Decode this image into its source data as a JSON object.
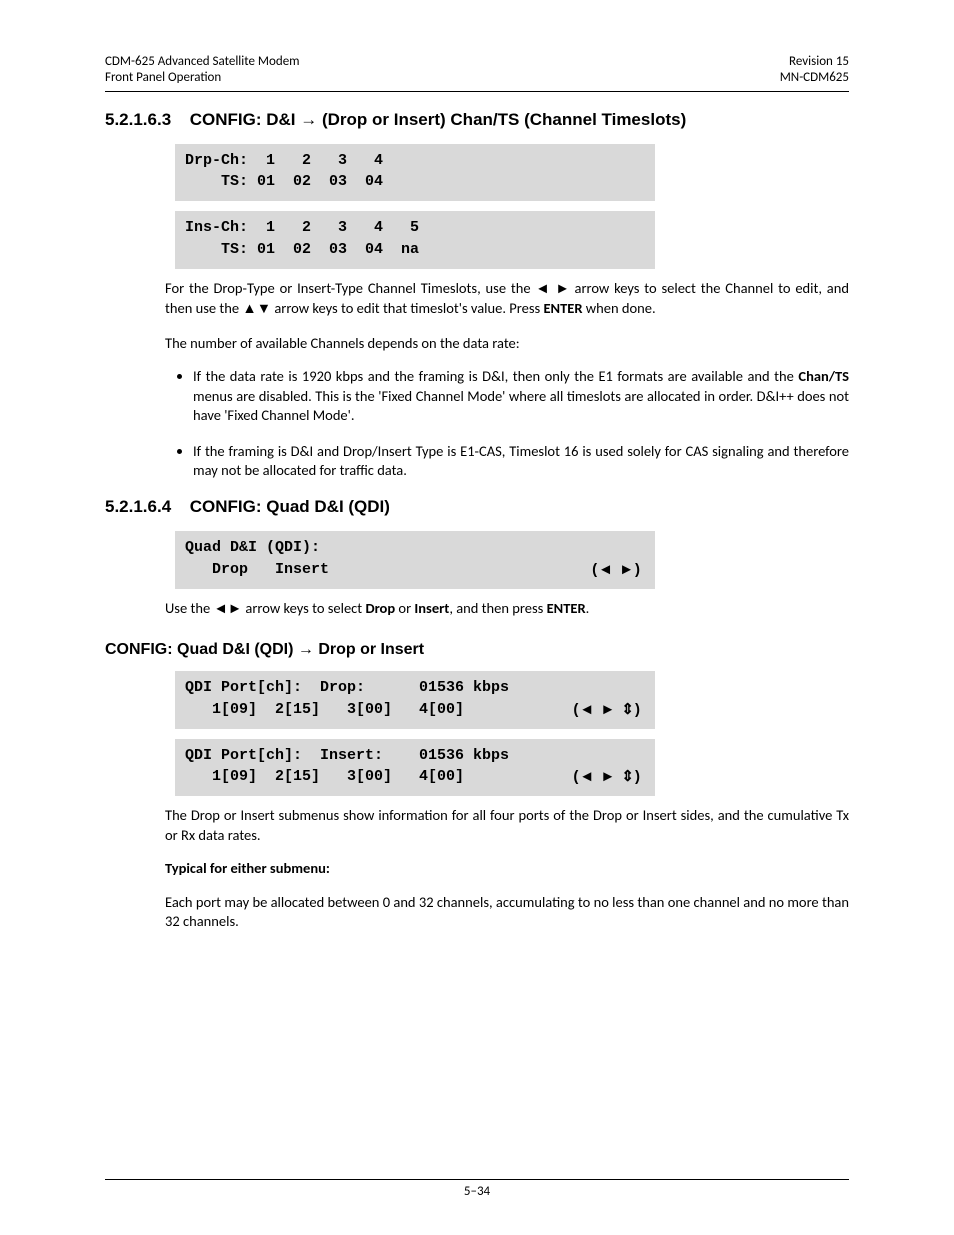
{
  "header": {
    "left1": "CDM-625 Advanced Satellite Modem",
    "left2": "Front Panel Operation",
    "right1": "Revision 15",
    "right2": "MN-CDM625"
  },
  "sec1": {
    "num": "5.2.1.6.3",
    "title_pre": "CONFIG: D&I ",
    "arrow": "→",
    "title_post": " (Drop or Insert) Chan/TS (Channel Timeslots)"
  },
  "lcd1": "Drp-Ch:  1   2   3   4\n    TS: 01  02  03  04",
  "lcd2": "Ins-Ch:  1   2   3   4   5\n    TS: 01  02  03  04  na",
  "para1_a": "For the Drop-Type or Insert-Type Channel Timeslots, use the ",
  "para1_lr": "◄ ►",
  "para1_b": " arrow keys to select the Channel to edit, and then use the ",
  "para1_ud": "▲▼",
  "para1_c": " arrow keys to edit that timeslot's value. Press ",
  "para1_enter": "ENTER",
  "para1_d": " when done.",
  "para2": "The number of available Channels depends on the data rate:",
  "bullet1_a": "If the data rate is 1920 kbps and the framing is D&I, then only the E1 formats are available and the ",
  "bullet1_bold": "Chan/TS",
  "bullet1_b": " menus are disabled. This is the 'Fixed Channel Mode' where all timeslots are allocated in order. D&I++ does not have 'Fixed Channel Mode'.",
  "bullet2": "If the framing is D&I and Drop/Insert Type is E1-CAS, Timeslot 16 is used solely for CAS signaling and therefore may not be allocated for traffic data.",
  "sec2": {
    "num": "5.2.1.6.4",
    "title": "CONFIG: Quad D&I (QDI)"
  },
  "lcd3_line1": "Quad D&I (QDI):",
  "lcd3_line2": "   Drop   Insert",
  "lcd3_arrows": "(◄ ►)",
  "para3_a": "Use the ",
  "para3_lr": "◄►",
  "para3_b": " arrow keys to select ",
  "para3_drop": "Drop",
  "para3_or": " or ",
  "para3_insert": "Insert",
  "para3_c": ", and then press ",
  "para3_enter": "ENTER",
  "para3_d": ".",
  "sub1_a": "CONFIG: Quad D&I (QDI) ",
  "sub1_arrow": "→",
  "sub1_b": " Drop or Insert",
  "lcd4_line1": "QDI Port[ch]:  Drop:      01536 kbps",
  "lcd4_line2": "   1[09]  2[15]   3[00]   4[00]",
  "lcd4_arrows": "(◄ ► ⇕)",
  "lcd5_line1": "QDI Port[ch]:  Insert:    01536 kbps",
  "lcd5_line2": "   1[09]  2[15]   3[00]   4[00]",
  "lcd5_arrows": "(◄ ► ⇕)",
  "para4": "The Drop or Insert submenus show information for all four ports of the Drop or Insert sides, and the cumulative Tx or Rx data rates.",
  "para5_label": "Typical for either submenu:",
  "para6": "Each port may be allocated between 0 and 32 channels, accumulating to no less than one channel and no more than 32 channels.",
  "footer": "5–34"
}
